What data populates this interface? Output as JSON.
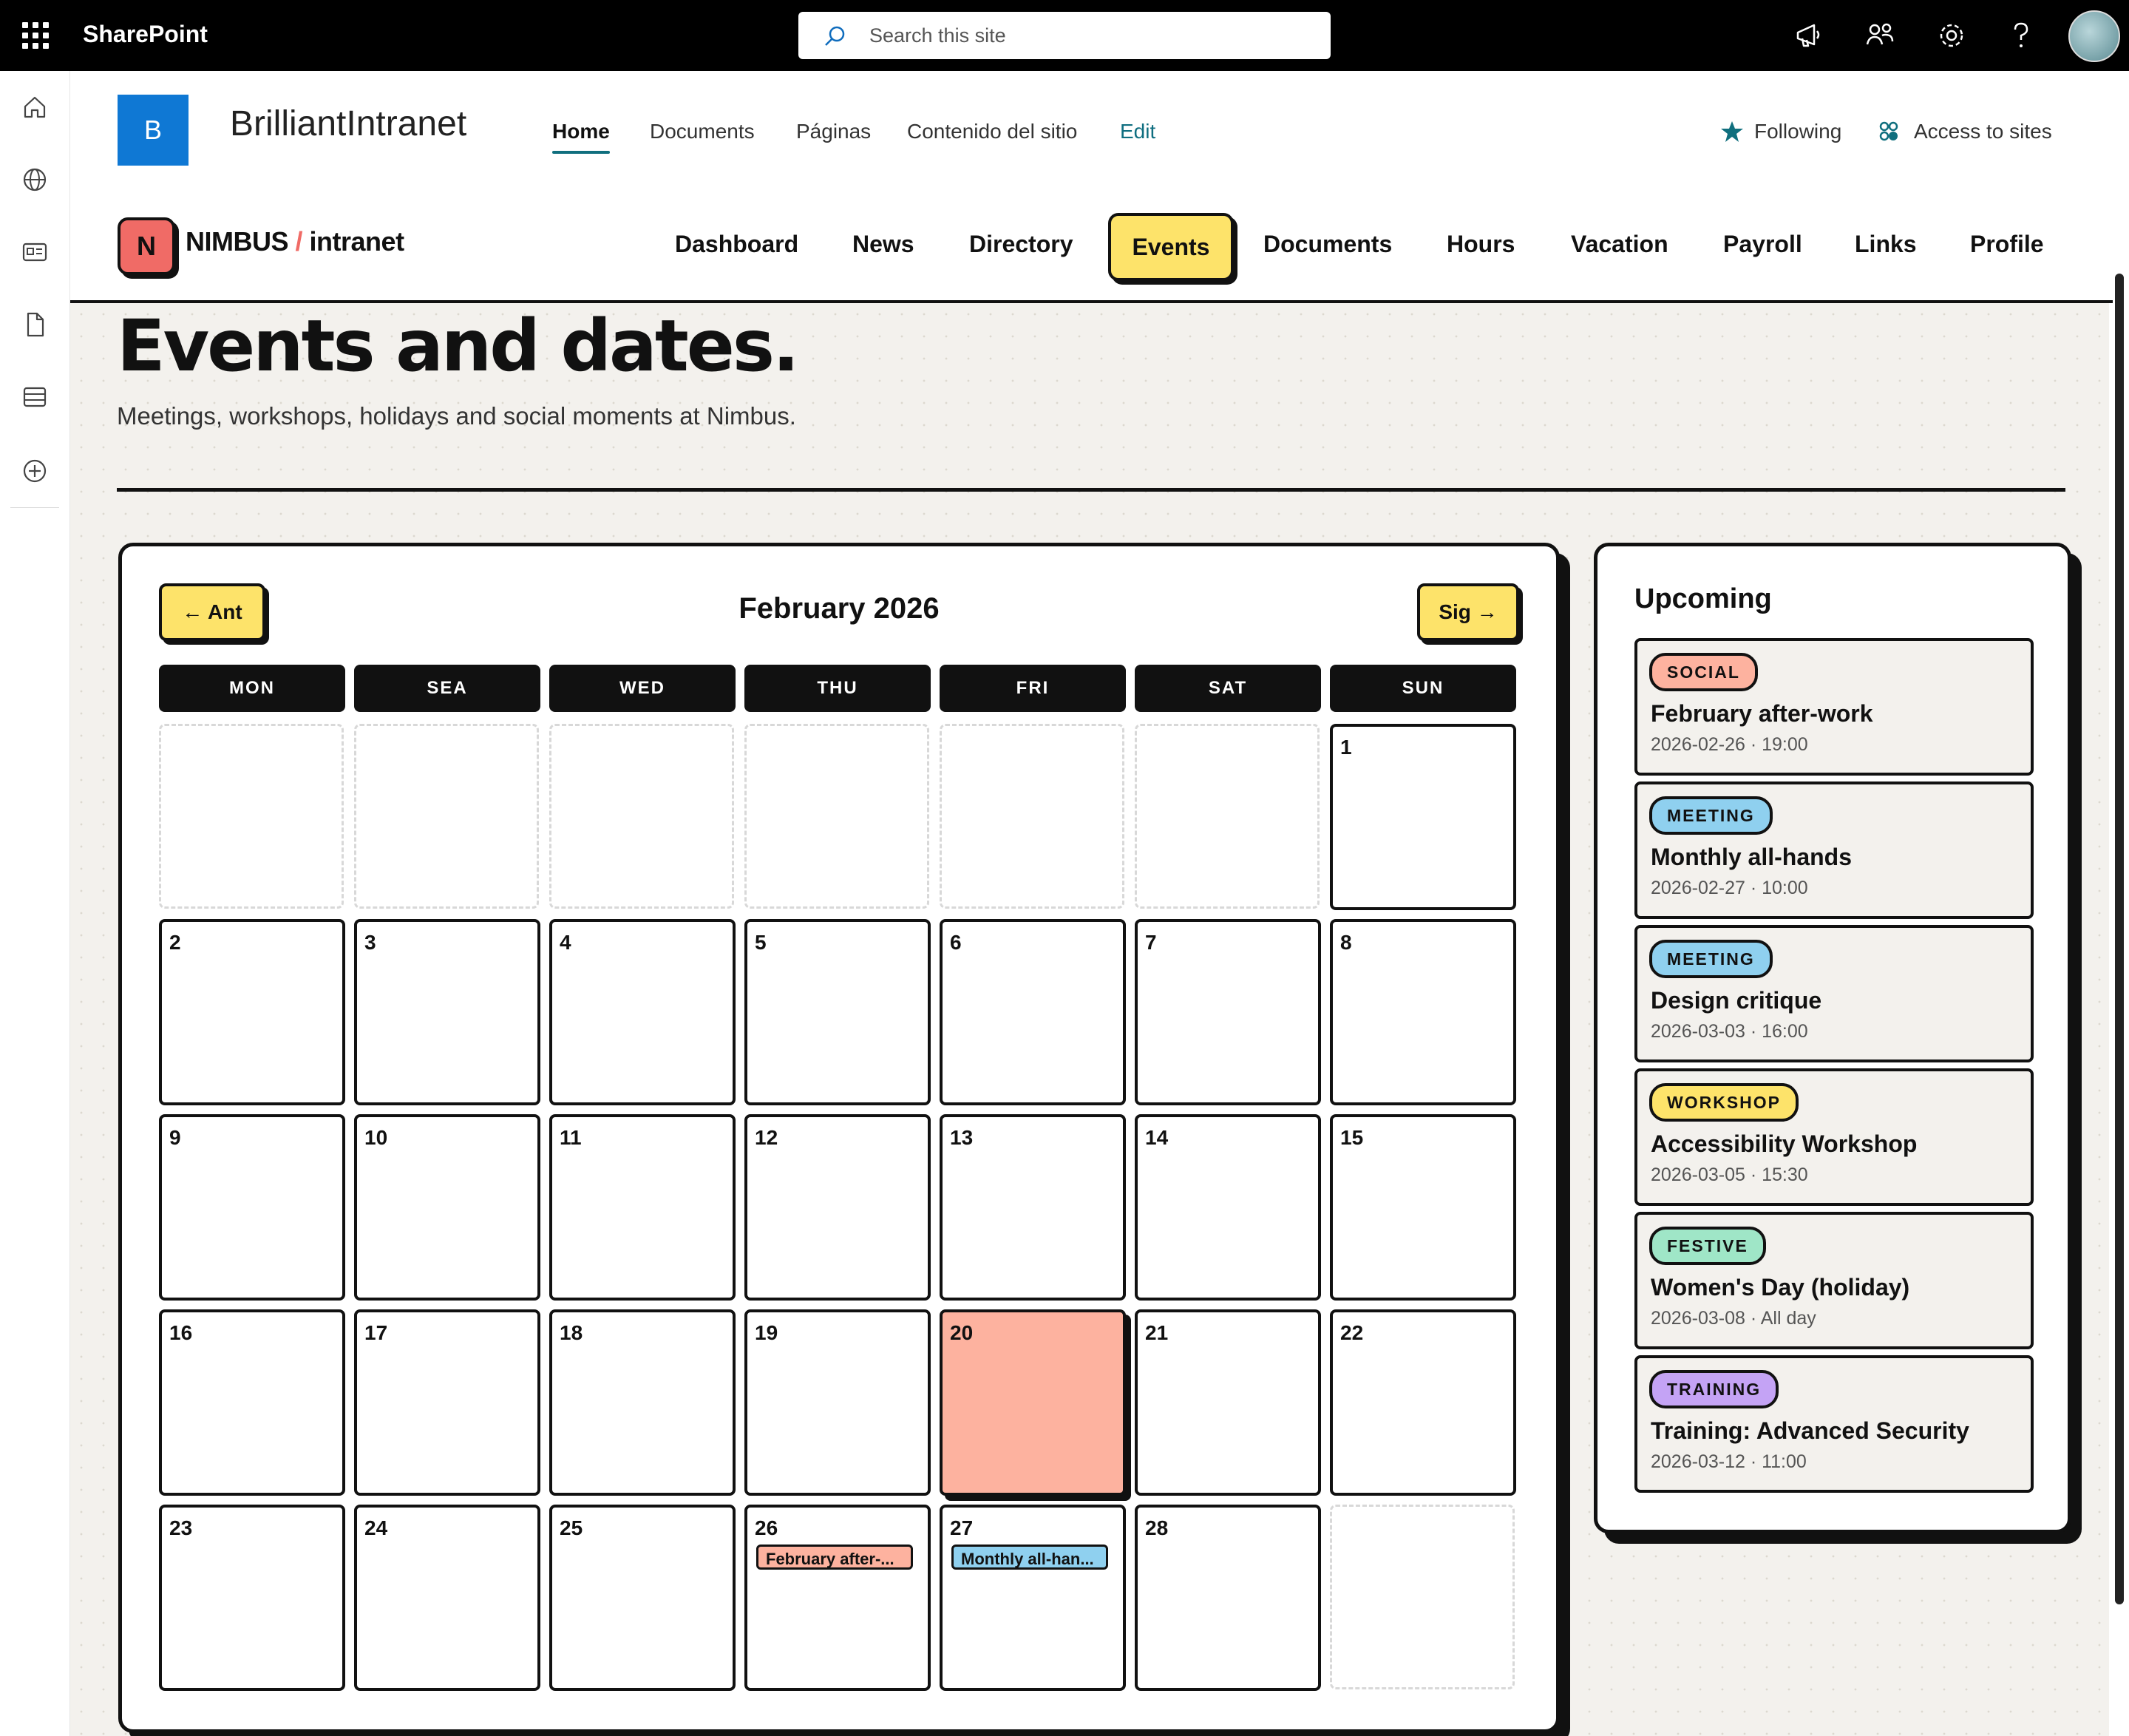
{
  "suitebar": {
    "brand": "SharePoint",
    "search_placeholder": "Search this site",
    "icons": [
      "megaphone-icon",
      "share-icon",
      "settings-icon",
      "help-icon"
    ]
  },
  "rail": {
    "icons": [
      "home-icon",
      "globe-icon",
      "news-icon",
      "file-icon",
      "list-icon",
      "add-icon"
    ]
  },
  "site": {
    "logo_letter": "B",
    "title": "BrilliantIntranet",
    "nav": [
      "Home",
      "Documents",
      "Páginas",
      "Contenido del sitio",
      "Edit"
    ],
    "following_label": "Following",
    "access_label": "Access to sites"
  },
  "nimbus": {
    "logo_letter": "N",
    "brand_main": "NIMBUS",
    "brand_slash": "/",
    "brand_sub": "intranet",
    "nav": [
      "Dashboard",
      "News",
      "Directory",
      "Events",
      "Documents",
      "Hours",
      "Vacation",
      "Payroll",
      "Links",
      "Profile"
    ],
    "active": "Events"
  },
  "page": {
    "title": "Events and dates.",
    "subtitle": "Meetings, workshops, holidays and social moments at Nimbus."
  },
  "calendar": {
    "prev_label": "← Ant",
    "next_label": "Sig →",
    "month_label": "February 2026",
    "weekdays": [
      "MON",
      "SEA",
      "WED",
      "THU",
      "FRI",
      "SAT",
      "SUN"
    ],
    "weeks": [
      [
        null,
        null,
        null,
        null,
        null,
        null,
        1
      ],
      [
        2,
        3,
        4,
        5,
        6,
        7,
        8
      ],
      [
        9,
        10,
        11,
        12,
        13,
        14,
        15
      ],
      [
        16,
        17,
        18,
        19,
        20,
        21,
        22
      ],
      [
        23,
        24,
        25,
        26,
        27,
        28,
        null
      ]
    ],
    "today": 20,
    "events": [
      {
        "day": 26,
        "label": "February after-...",
        "color": "#fdb29f"
      },
      {
        "day": 27,
        "label": "Monthly all-han...",
        "color": "#8fd0ef"
      }
    ]
  },
  "upcoming": {
    "title": "Upcoming",
    "items": [
      {
        "tag": "SOCIAL",
        "tag_color": "#fdb29f",
        "name": "February after-work",
        "date": "2026-02-26 · 19:00"
      },
      {
        "tag": "MEETING",
        "tag_color": "#8fd0ef",
        "name": "Monthly all-hands",
        "date": "2026-02-27 · 10:00"
      },
      {
        "tag": "MEETING",
        "tag_color": "#8fd0ef",
        "name": "Design critique",
        "date": "2026-03-03 · 16:00"
      },
      {
        "tag": "WORKSHOP",
        "tag_color": "#fde36a",
        "name": "Accessibility Workshop",
        "date": "2026-03-05 · 15:30"
      },
      {
        "tag": "FESTIVE",
        "tag_color": "#9fe6c7",
        "name": "Women's Day (holiday)",
        "date": "2026-03-08 · All day"
      },
      {
        "tag": "TRAINING",
        "tag_color": "#c4a3f5",
        "name": "Training: Advanced Security",
        "date": "2026-03-12 · 11:00"
      }
    ]
  }
}
